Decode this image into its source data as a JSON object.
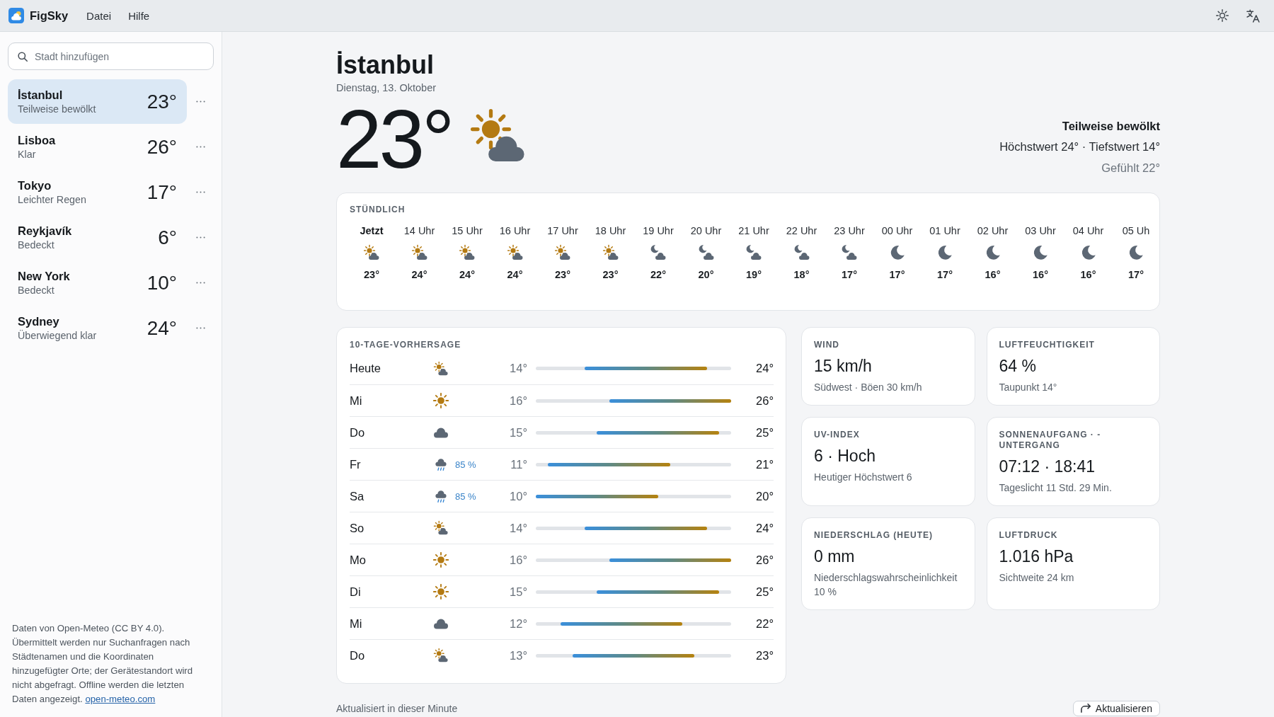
{
  "app": {
    "name": "FigSky"
  },
  "menu": [
    "Datei",
    "Hilfe"
  ],
  "search": {
    "placeholder": "Stadt hinzufügen"
  },
  "cities": [
    {
      "name": "İstanbul",
      "condition": "Teilweise bewölkt",
      "temp": "23°",
      "selected": true
    },
    {
      "name": "Lisboa",
      "condition": "Klar",
      "temp": "26°",
      "selected": false
    },
    {
      "name": "Tokyo",
      "condition": "Leichter Regen",
      "temp": "17°",
      "selected": false
    },
    {
      "name": "Reykjavík",
      "condition": "Bedeckt",
      "temp": "6°",
      "selected": false
    },
    {
      "name": "New York",
      "condition": "Bedeckt",
      "temp": "10°",
      "selected": false
    },
    {
      "name": "Sydney",
      "condition": "Überwiegend klar",
      "temp": "24°",
      "selected": false
    }
  ],
  "attribution": {
    "text": "Daten von Open-Meteo (CC BY 4.0). Übermittelt werden nur Suchanfragen nach Städtenamen und die Koordinaten hinzugefügter Orte; der Gerätestandort wird nicht abgefragt. Offline werden die letzten Daten angezeigt.",
    "link": "open-meteo.com"
  },
  "current": {
    "city": "İstanbul",
    "date": "Dienstag, 13. Oktober",
    "temp": "23°",
    "kind": "partly-cloudy",
    "condition": "Teilweise bewölkt",
    "high_low": "Höchstwert 24° · Tiefstwert 14°",
    "feels_like": "Gefühlt 22°"
  },
  "hourly": {
    "title": "STÜNDLICH",
    "hours": [
      {
        "time": "Jetzt",
        "kind": "partly-cloudy",
        "temp": "23°",
        "current": true
      },
      {
        "time": "14 Uhr",
        "kind": "partly-cloudy",
        "temp": "24°",
        "current": false
      },
      {
        "time": "15 Uhr",
        "kind": "partly-cloudy",
        "temp": "24°",
        "current": false
      },
      {
        "time": "16 Uhr",
        "kind": "partly-cloudy",
        "temp": "24°",
        "current": false
      },
      {
        "time": "17 Uhr",
        "kind": "partly-cloudy",
        "temp": "23°",
        "current": false
      },
      {
        "time": "18 Uhr",
        "kind": "partly-cloudy",
        "temp": "23°",
        "current": false
      },
      {
        "time": "19 Uhr",
        "kind": "partly-cloudy-night",
        "temp": "22°",
        "current": false
      },
      {
        "time": "20 Uhr",
        "kind": "partly-cloudy-night",
        "temp": "20°",
        "current": false
      },
      {
        "time": "21 Uhr",
        "kind": "partly-cloudy-night",
        "temp": "19°",
        "current": false
      },
      {
        "time": "22 Uhr",
        "kind": "partly-cloudy-night",
        "temp": "18°",
        "current": false
      },
      {
        "time": "23 Uhr",
        "kind": "partly-cloudy-night",
        "temp": "17°",
        "current": false
      },
      {
        "time": "00 Uhr",
        "kind": "clear-night",
        "temp": "17°",
        "current": false
      },
      {
        "time": "01 Uhr",
        "kind": "clear-night",
        "temp": "17°",
        "current": false
      },
      {
        "time": "02 Uhr",
        "kind": "clear-night",
        "temp": "16°",
        "current": false
      },
      {
        "time": "03 Uhr",
        "kind": "clear-night",
        "temp": "16°",
        "current": false
      },
      {
        "time": "04 Uhr",
        "kind": "clear-night",
        "temp": "16°",
        "current": false
      },
      {
        "time": "05 Uh",
        "kind": "clear-night",
        "temp": "17°",
        "current": false
      }
    ]
  },
  "forecast": {
    "title": "10-TAGE-VORHERSAGE",
    "days": [
      {
        "day": "Heute",
        "kind": "partly-cloudy",
        "low": "14°",
        "high": "24°"
      },
      {
        "day": "Mi",
        "kind": "clear",
        "low": "16°",
        "high": "26°"
      },
      {
        "day": "Do",
        "kind": "cloudy",
        "low": "15°",
        "high": "25°"
      },
      {
        "day": "Fr",
        "kind": "rain",
        "precip": "85 %",
        "low": "11°",
        "high": "21°"
      },
      {
        "day": "Sa",
        "kind": "rain",
        "precip": "85 %",
        "low": "10°",
        "high": "20°"
      },
      {
        "day": "So",
        "kind": "partly-cloudy",
        "low": "14°",
        "high": "24°"
      },
      {
        "day": "Mo",
        "kind": "clear",
        "low": "16°",
        "high": "26°"
      },
      {
        "day": "Di",
        "kind": "clear",
        "low": "15°",
        "high": "25°"
      },
      {
        "day": "Mi",
        "kind": "cloudy",
        "low": "12°",
        "high": "22°"
      },
      {
        "day": "Do",
        "kind": "partly-cloudy",
        "low": "13°",
        "high": "23°"
      }
    ]
  },
  "details": [
    {
      "label": "WIND",
      "value": "15 km/h",
      "note": "Südwest · Böen 30 km/h"
    },
    {
      "label": "LUFTFEUCHTIGKEIT",
      "value": "64 %",
      "note": "Taupunkt 14°"
    },
    {
      "label": "UV-INDEX",
      "value": "6 · Hoch",
      "note": "Heutiger Höchstwert 6"
    },
    {
      "label": "SONNENAUFGANG · -UNTERGANG",
      "value": "07:12 · 18:41",
      "note": "Tageslicht 11 Std. 29 Min."
    },
    {
      "label": "NIEDERSCHLAG (HEUTE)",
      "value": "0 mm",
      "note": "Niederschlagswahrscheinlichkeit 10 %"
    },
    {
      "label": "LUFTDRUCK",
      "value": "1.016 hPa",
      "note": "Sichtweite 24 km"
    }
  ],
  "footer": {
    "updated": "Aktualisiert in dieser Minute",
    "refresh_button": "Aktualisieren"
  }
}
